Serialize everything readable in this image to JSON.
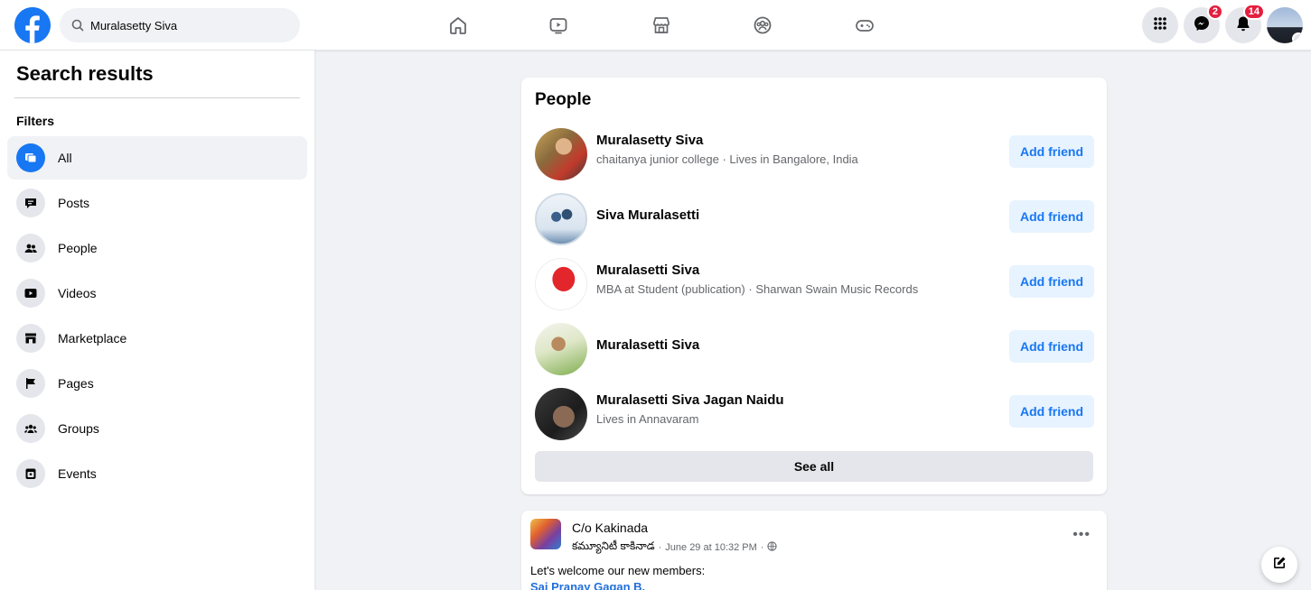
{
  "colors": {
    "brand": "#1877f2",
    "badge": "#e41e3f",
    "add_friend_bg": "#e7f3ff",
    "page_bg": "#f0f2f5"
  },
  "topbar": {
    "search": {
      "value": "Muralasetty Siva",
      "icon": "search-icon"
    },
    "nav_icons": [
      "home-icon",
      "watch-icon",
      "marketplace-icon",
      "groups-icon",
      "gaming-icon"
    ],
    "right": {
      "menu_icon": "grid-menu-icon",
      "messenger_badge": "2",
      "notifications_badge": "14"
    }
  },
  "sidebar": {
    "title": "Search results",
    "filters_label": "Filters",
    "items": [
      {
        "label": "All",
        "icon": "all-results-icon",
        "active": true
      },
      {
        "label": "Posts",
        "icon": "posts-icon"
      },
      {
        "label": "People",
        "icon": "people-icon"
      },
      {
        "label": "Videos",
        "icon": "videos-icon"
      },
      {
        "label": "Marketplace",
        "icon": "marketplace-icon"
      },
      {
        "label": "Pages",
        "icon": "pages-icon"
      },
      {
        "label": "Groups",
        "icon": "groups-icon"
      },
      {
        "label": "Events",
        "icon": "events-icon"
      }
    ]
  },
  "people": {
    "title": "People",
    "add_label": "Add friend",
    "see_all": "See all",
    "results": [
      {
        "name": "Muralasetty Siva",
        "subtitle": "chaitanya junior college · Lives in Bangalore, India"
      },
      {
        "name": "Siva Muralasetti",
        "subtitle": ""
      },
      {
        "name": "Muralasetti Siva",
        "subtitle": "MBA at Student (publication) · Sharwan Swain Music Records"
      },
      {
        "name": "Muralasetti Siva",
        "subtitle": ""
      },
      {
        "name": "Muralasetti Siva Jagan Naidu",
        "subtitle": "Lives in Annavaram"
      }
    ]
  },
  "post": {
    "group_name": "C/o Kakinada",
    "author": "కమ్యూనిటీ కాకినాడ",
    "time": "June 29 at 10:32 PM",
    "separator": "·",
    "body": "Let's welcome our new members:",
    "mention": "Sai Pranay Gagan B."
  }
}
